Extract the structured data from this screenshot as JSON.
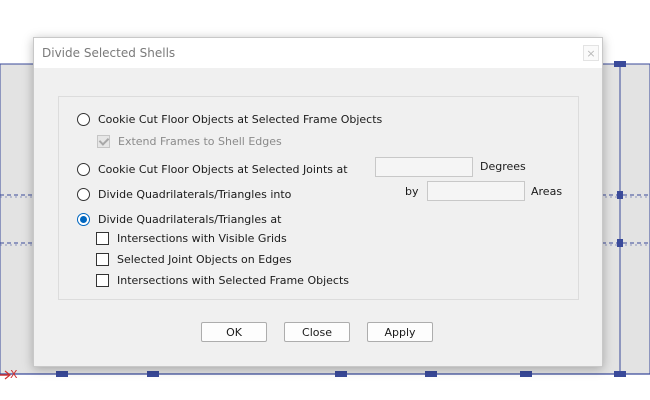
{
  "dialog": {
    "title": "Divide Selected Shells",
    "close_glyph": "×"
  },
  "options": {
    "cookie_cut_frames": {
      "label": "Cookie Cut Floor Objects at Selected Frame Objects",
      "selected": false
    },
    "extend_frames": {
      "label": "Extend Frames to Shell Edges",
      "checked": true,
      "enabled": false
    },
    "cookie_cut_joints": {
      "label": "Cookie Cut Floor Objects at Selected Joints at",
      "selected": false
    },
    "divide_into": {
      "label": "Divide Quadrilaterals/Triangles into",
      "selected": false
    },
    "divide_at": {
      "label": "Divide Quadrilaterals/Triangles at",
      "selected": true
    },
    "visible_grids": {
      "label": "Intersections with Visible Grids",
      "checked": false
    },
    "joint_objects": {
      "label": "Selected Joint Objects on Edges",
      "checked": false
    },
    "frame_objects": {
      "label": "Intersections with Selected Frame Objects",
      "checked": false
    }
  },
  "fields": {
    "degrees": {
      "value": "",
      "unit": "Degrees"
    },
    "by_label": "by",
    "areas": {
      "value": "",
      "unit": "Areas"
    }
  },
  "buttons": {
    "ok": "OK",
    "close": "Close",
    "apply": "Apply"
  },
  "background": {
    "axis_label": "X"
  },
  "colors": {
    "accent": "#0067c0",
    "model_line": "#3a4a9a"
  }
}
